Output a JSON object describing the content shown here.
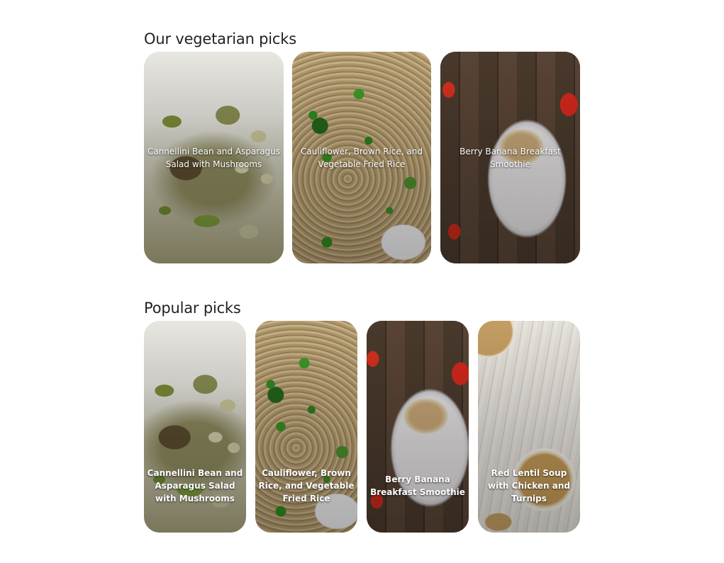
{
  "sections": [
    {
      "title": "Our vegetarian picks",
      "cards": [
        {
          "label": "Cannellini Bean and Asparagus Salad with Mushrooms",
          "image": "salad-photo"
        },
        {
          "label": "Cauliflower, Brown Rice, and Vegetable Fried Rice",
          "image": "fried-rice-photo"
        },
        {
          "label": "Berry Banana Breakfast Smoothie",
          "image": "smoothie-photo"
        }
      ]
    },
    {
      "title": "Popular picks",
      "cards": [
        {
          "label": "Cannellini Bean and Asparagus Salad with Mushrooms",
          "image": "salad-photo"
        },
        {
          "label": "Cauliflower, Brown Rice, and Vegetable Fried Rice",
          "image": "fried-rice-photo"
        },
        {
          "label": "Berry Banana Breakfast Smoothie",
          "image": "smoothie-photo"
        },
        {
          "label": "Red Lentil Soup with Chicken and Turnips",
          "image": "soup-photo"
        }
      ]
    }
  ]
}
